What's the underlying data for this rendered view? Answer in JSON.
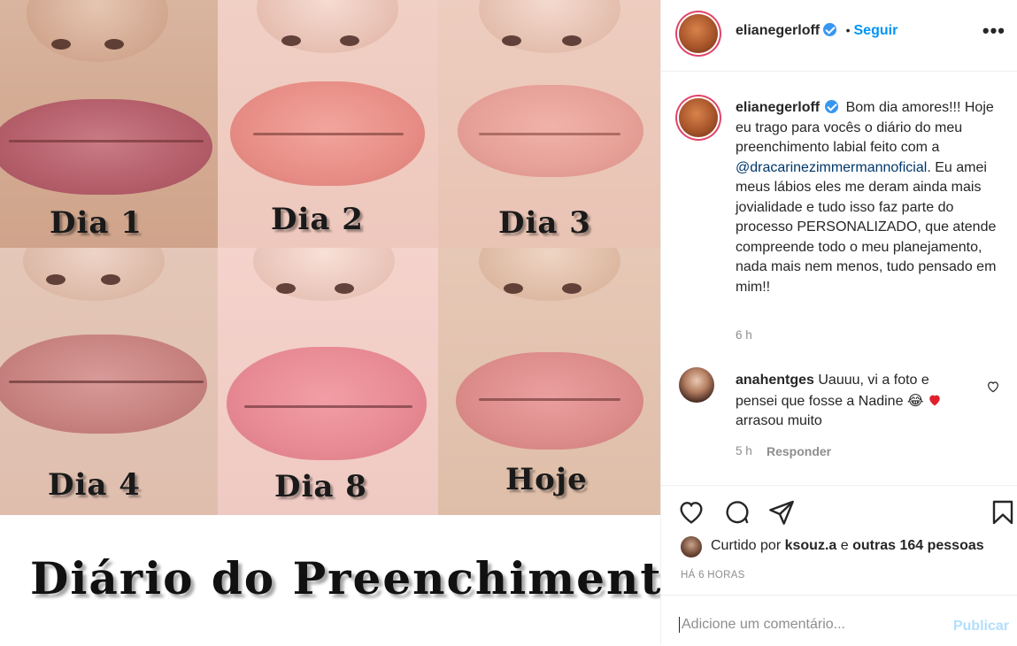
{
  "post": {
    "tiles": [
      {
        "label": "Dia 1"
      },
      {
        "label": "Dia 2"
      },
      {
        "label": "Dia 3"
      },
      {
        "label": "Dia 4"
      },
      {
        "label": "Dia 8"
      },
      {
        "label": "Hoje"
      }
    ],
    "caption_overlay": "Diário do Preenchimento!"
  },
  "header": {
    "username": "elianegerloff",
    "separator": "•",
    "follow_label": "Seguir",
    "more_label": "•••"
  },
  "caption": {
    "username": "elianegerloff",
    "text_1": "Bom dia amores!!! Hoje eu trago para vocês o diário do meu preenchimento labial feito com a ",
    "mention": "@dracarinezimmermannoficial",
    "text_2": ". Eu amei meus lábios eles me deram ainda mais jovialidade e tudo isso faz parte do processo PERSONALIZADO, que atende compreende todo o meu planejamento, nada mais nem menos, tudo pensado em mim!!",
    "time": "6 h"
  },
  "comment": {
    "username": "anahentges",
    "text": "Uauuu, vi a foto e pensei que fosse a Nadine",
    "emoji": "😂",
    "text_after": "arrasou muito",
    "time": "5 h",
    "reply_label": "Responder"
  },
  "likes": {
    "prefix": "Curtido por",
    "user": "ksouz.a",
    "connector": "e",
    "others": "outras 164 pessoas"
  },
  "timestamp": "HÁ 6 HORAS",
  "add_comment": {
    "placeholder": "Adicione um comentário...",
    "publish_label": "Publicar"
  },
  "colors": {
    "link_blue": "#0095f6",
    "mention": "#00376b",
    "muted": "#8e8e8e",
    "publish_disabled": "#b2dffc",
    "heart_red": "#ed4956"
  },
  "icons": [
    "heart-icon",
    "comment-icon",
    "share-icon",
    "bookmark-icon",
    "verified-icon",
    "more-icon",
    "small-heart-icon"
  ]
}
